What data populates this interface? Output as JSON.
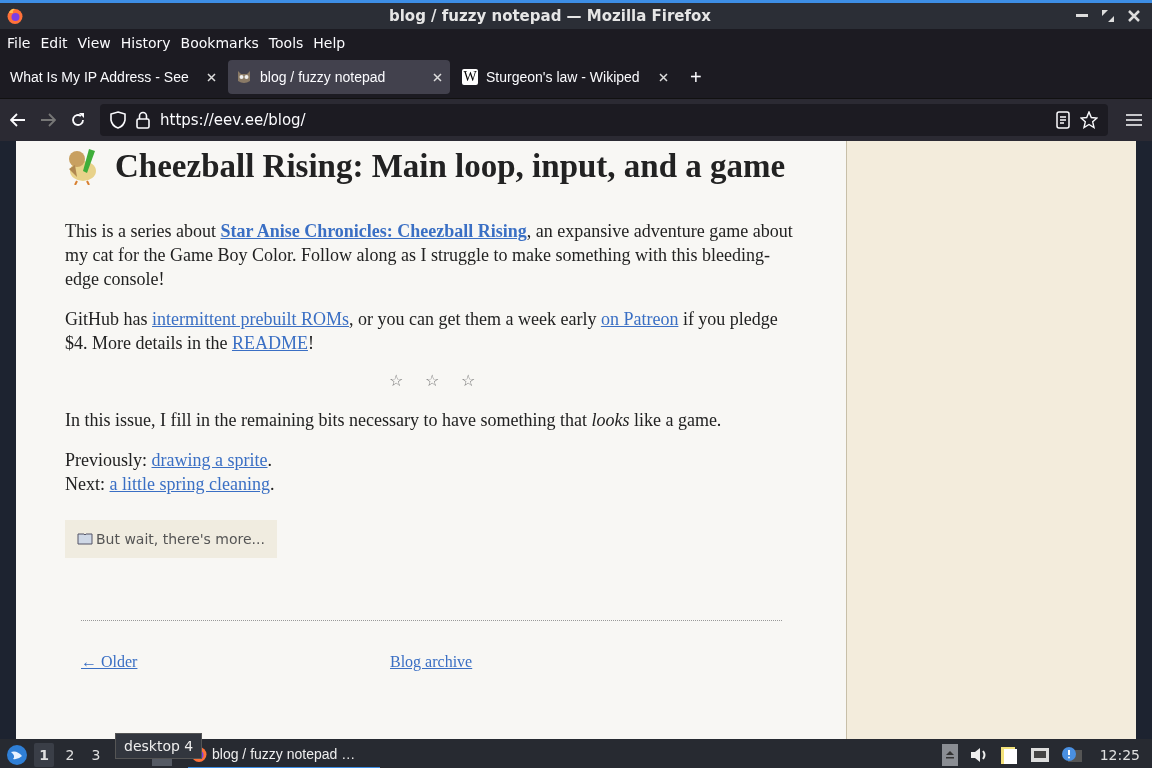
{
  "window": {
    "title": "blog / fuzzy notepad — Mozilla Firefox"
  },
  "menu": [
    "File",
    "Edit",
    "View",
    "History",
    "Bookmarks",
    "Tools",
    "Help"
  ],
  "tabs": [
    {
      "label": "What Is My IP Address - See",
      "selected": false
    },
    {
      "label": "blog / fuzzy notepad",
      "selected": true,
      "kind": "drawn_icon"
    },
    {
      "label": "Sturgeon's law - Wikiped",
      "selected": false,
      "kind": "glyph_icon",
      "icon_glyph": "W"
    }
  ],
  "new_tab": "+",
  "nav": {
    "back_disabled": false,
    "forward_disabled": true,
    "url": "https://eev.ee/blog/"
  },
  "article": {
    "title": "Cheezball Rising: Main loop, input, and a game",
    "intro": [
      [
        {
          "kind": "text",
          "text": "This is a series about "
        },
        {
          "kind": "link",
          "text": "Star Anise Chronicles: Cheezball Rising",
          "bold": true
        },
        {
          "kind": "text",
          "text": ", an expansive adventure game about my cat for the Game Boy Color. Follow along as I struggle to make something with this bleeding-edge console!"
        }
      ],
      [
        {
          "kind": "text",
          "text": "GitHub has "
        },
        {
          "kind": "link",
          "text": "intermittent prebuilt ROMs",
          "bold": false
        },
        {
          "kind": "text",
          "text": ", or you can get them a week early "
        },
        {
          "kind": "link",
          "text": "on Patreon",
          "bold": false
        },
        {
          "kind": "text",
          "text": " if you pledge $4. More details in the "
        },
        {
          "kind": "link",
          "text": "README",
          "bold": false
        },
        {
          "kind": "text",
          "text": "!"
        }
      ]
    ],
    "divider": "☆ ☆ ☆",
    "summary": "In this issue, I fill in the remaining bits necessary to have something that *looks* like a game.",
    "series_nav": [
      {
        "label": "Previously:",
        "link": "drawing a sprite",
        "end": "."
      },
      {
        "label": "Next:",
        "link": "a little spring cleaning",
        "end": "."
      }
    ],
    "more_button": "But wait, there's more..."
  },
  "footer": {
    "older": "← Older",
    "archive": "Blog archive"
  },
  "taskbar": {
    "desktops": [
      {
        "label": "1",
        "selected": true
      },
      {
        "label": "2",
        "selected": false
      },
      {
        "label": "3",
        "selected": false
      }
    ],
    "tooltip": "desktop 4",
    "task": {
      "label": "blog / fuzzy notepad …",
      "selected": true
    },
    "clock": "12:25"
  }
}
